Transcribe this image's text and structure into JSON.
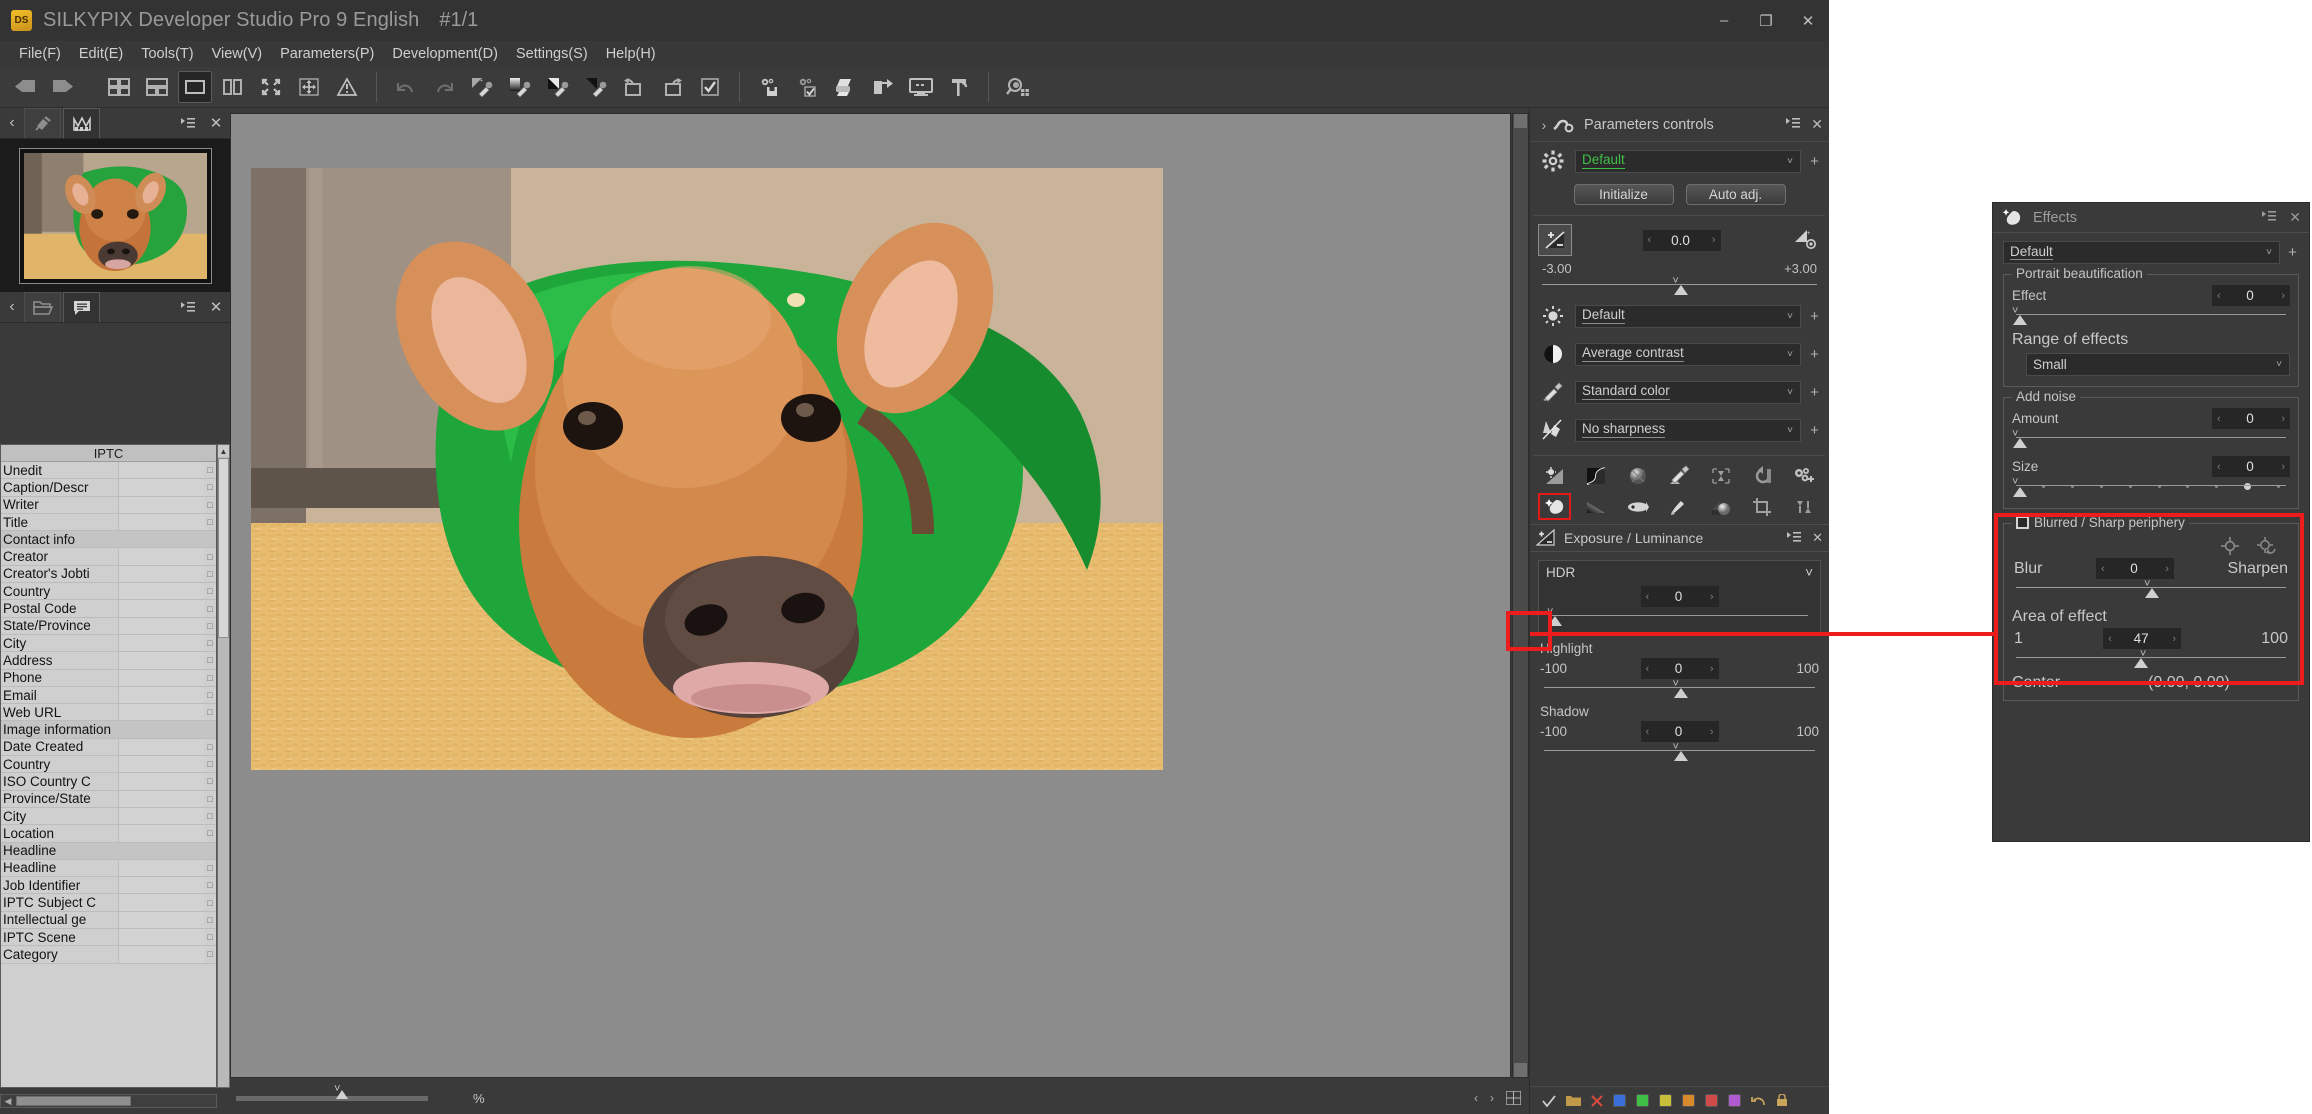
{
  "window": {
    "logo_text": "DS",
    "title": "SILKYPIX Developer Studio Pro 9 English",
    "index": "#1/1",
    "minimize": "–",
    "maximize": "❐",
    "close": "✕"
  },
  "menubar": {
    "items": [
      {
        "label": "File(F)",
        "accel": "F"
      },
      {
        "label": "Edit(E)",
        "accel": "E"
      },
      {
        "label": "Tools(T)",
        "accel": "T"
      },
      {
        "label": "View(V)",
        "accel": "V"
      },
      {
        "label": "Parameters(P)",
        "accel": "P"
      },
      {
        "label": "Development(D)",
        "accel": "D"
      },
      {
        "label": "Settings(S)",
        "accel": "S"
      },
      {
        "label": "Help(H)",
        "accel": "H"
      }
    ]
  },
  "toolbar": {
    "icons": [
      "previous-image-icon",
      "next-image-icon",
      "thumbnail-grid-icon",
      "thumbnail-detail-icon",
      "single-view-icon",
      "compare-view-icon",
      "fullscreen-icon",
      "fit-screen-icon",
      "warning-icon",
      "undo-icon",
      "redo-icon",
      "taste-minus-icon",
      "gradation-taste-icon",
      "black-white-taste-icon",
      "taste-copy-icon",
      "rotate-left-icon",
      "rotate-right-icon",
      "mark-checkbox-icon",
      "develop-save-icon",
      "develop-check-icon",
      "print-icon",
      "export-icon",
      "slideshow-icon",
      "hammer-icon",
      "search-thumbnail-icon"
    ]
  },
  "left_panel": {
    "top_tabs": {
      "collapse_arrow": "‹",
      "tabs": [
        "pin-thumbnail-icon",
        "histogram-icon"
      ],
      "selected_index": 1,
      "menu_icon": "panel-menu-icon",
      "close_icon": "✕"
    },
    "thumbnail": {
      "alt": "calf-photo-thumbnail"
    },
    "meta_tabs": {
      "collapse_arrow": "‹",
      "tabs": [
        "folder-icon",
        "metadata-icon"
      ],
      "selected_index": 1,
      "menu_icon": "panel-menu-icon",
      "close_icon": "✕"
    },
    "iptc": {
      "header": "IPTC",
      "rows": [
        {
          "label": "Unedit",
          "value": "",
          "group": false,
          "dot": true
        },
        {
          "label": "Caption/Descr",
          "value": "",
          "group": false,
          "dot": true
        },
        {
          "label": "Writer",
          "value": "",
          "group": false,
          "dot": true
        },
        {
          "label": "Title",
          "value": "",
          "group": false,
          "dot": true
        },
        {
          "label": "Contact info",
          "value": "",
          "group": true,
          "dot": false
        },
        {
          "label": "Creator",
          "value": "",
          "group": false,
          "dot": true
        },
        {
          "label": "Creator's Jobti",
          "value": "",
          "group": false,
          "dot": true
        },
        {
          "label": "Country",
          "value": "",
          "group": false,
          "dot": true
        },
        {
          "label": "Postal Code",
          "value": "",
          "group": false,
          "dot": true
        },
        {
          "label": "State/Province",
          "value": "",
          "group": false,
          "dot": true
        },
        {
          "label": "City",
          "value": "",
          "group": false,
          "dot": true
        },
        {
          "label": "Address",
          "value": "",
          "group": false,
          "dot": true
        },
        {
          "label": "Phone",
          "value": "",
          "group": false,
          "dot": true
        },
        {
          "label": "Email",
          "value": "",
          "group": false,
          "dot": true
        },
        {
          "label": "Web URL",
          "value": "",
          "group": false,
          "dot": true
        },
        {
          "label": "Image information",
          "value": "",
          "group": true,
          "dot": false
        },
        {
          "label": "Date Created",
          "value": "",
          "group": false,
          "dot": true
        },
        {
          "label": "Country",
          "value": "",
          "group": false,
          "dot": true
        },
        {
          "label": "ISO Country C",
          "value": "",
          "group": false,
          "dot": true
        },
        {
          "label": "Province/State",
          "value": "",
          "group": false,
          "dot": true
        },
        {
          "label": "City",
          "value": "",
          "group": false,
          "dot": true
        },
        {
          "label": "Location",
          "value": "",
          "group": false,
          "dot": true
        },
        {
          "label": "Headline",
          "value": "",
          "group": true,
          "dot": false
        },
        {
          "label": "Headline",
          "value": "",
          "group": false,
          "dot": true
        },
        {
          "label": "Job Identifier",
          "value": "",
          "group": false,
          "dot": true
        },
        {
          "label": "IPTC Subject C",
          "value": "",
          "group": false,
          "dot": true
        },
        {
          "label": "Intellectual ge",
          "value": "",
          "group": false,
          "dot": true
        },
        {
          "label": "IPTC Scene",
          "value": "",
          "group": false,
          "dot": true
        },
        {
          "label": "Category",
          "value": "",
          "group": false,
          "dot": true
        }
      ]
    }
  },
  "center": {
    "photo_alt": "calf-in-green-blanket-photo",
    "zoom_percent_label": "%",
    "zoom_value": ""
  },
  "parameters_controls": {
    "title": "Parameters controls",
    "expand_arrow": "›",
    "menu_icon": "panel-menu-icon",
    "close_icon": "✕",
    "taste_combo": {
      "value": "Default",
      "plus": "+"
    },
    "initialize_label": "Initialize",
    "auto_adj_label": "Auto adj.",
    "exposure": {
      "value": "0.0",
      "min_label": "-3.00",
      "max_label": "+3.00",
      "icon": "exposure-icon",
      "aux_icon": "exposure-settings-icon"
    },
    "combos": [
      {
        "icon": "white-balance-icon",
        "value": "Default",
        "plus": "+"
      },
      {
        "icon": "contrast-icon",
        "value": "Average contrast",
        "plus": "+"
      },
      {
        "icon": "color-icon",
        "value": "Standard color",
        "plus": "+"
      },
      {
        "icon": "sharpness-icon",
        "value": "No sharpness",
        "plus": "+"
      }
    ],
    "tool_grid_row1": [
      "exposure-luminance-icon",
      "tone-curve-icon",
      "white-balance-ball-icon",
      "color-adjust-icon",
      "sharpness-tool-icon",
      "lens-aberration-icon",
      "custom-settings-icon"
    ],
    "tool_grid_row2": [
      "effects-icon",
      "gradation-icon",
      "fisheye-icon",
      "dodge-burn-icon",
      "clarity-icon",
      "crop-icon",
      "rotate-flip-icon"
    ],
    "highlighted_tool": "effects-icon"
  },
  "exposure_luminance": {
    "title": "Exposure / Luminance",
    "icon": "exposure-icon",
    "menu_icon": "panel-menu-icon",
    "close_icon": "✕",
    "hdr": {
      "label": "HDR",
      "value": "0"
    },
    "highlight": {
      "label": "Highlight",
      "value": "0",
      "min": "-100",
      "max": "100"
    },
    "shadow": {
      "label": "Shadow",
      "value": "0",
      "min": "-100",
      "max": "100"
    }
  },
  "footer": {
    "icons": [
      "check-icon",
      "folder-icon",
      "delete-icon"
    ],
    "swatches": [
      "#3a6fd8",
      "#3fbf46",
      "#c8c03a",
      "#d98a2b",
      "#d04a4a",
      "#b05ad0"
    ],
    "right_icons": [
      "undo-icon",
      "lock-icon"
    ]
  },
  "effects_panel": {
    "title": "Effects",
    "icon": "effects-icon",
    "menu_icon": "panel-menu-icon",
    "close_icon": "✕",
    "taste_combo": {
      "value": "Default",
      "plus": "+"
    },
    "portrait": {
      "legend": "Portrait beautification",
      "effect_label": "Effect",
      "effect_value": "0",
      "range_label": "Range of effects",
      "range_value": "Small"
    },
    "noise": {
      "legend": "Add noise",
      "amount_label": "Amount",
      "amount_value": "0",
      "size_label": "Size",
      "size_value": "0"
    },
    "periphery": {
      "legend": "Blurred / Sharp periphery",
      "checkbox_checked": false,
      "target_icon": "center-target-icon",
      "reset_icon": "reset-center-icon",
      "blur_label": "Blur",
      "sharpen_label": "Sharpen",
      "blur_value": "0",
      "area_label": "Area of effect",
      "area_value": "47",
      "area_min": "1",
      "area_max": "100",
      "center_label": "Center",
      "center_value": "(0.00, 0.00)"
    }
  },
  "annotations": {
    "highlight_color": "#ee1c1c",
    "callout": "connector-line-from-effects-tool-to-periphery-group"
  }
}
